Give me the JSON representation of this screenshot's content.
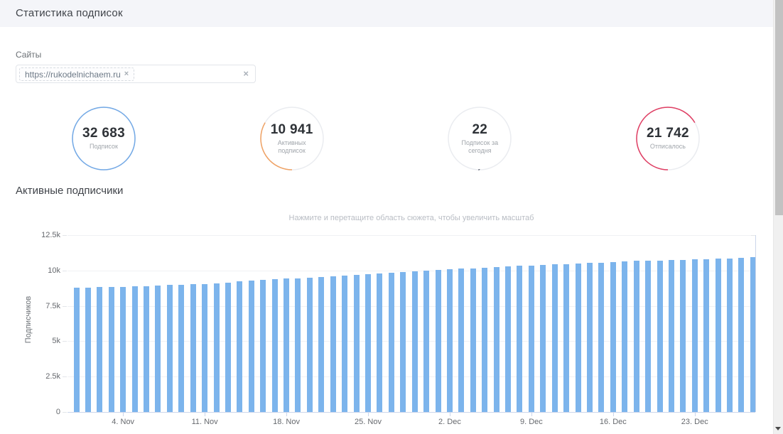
{
  "header": {
    "title": "Статистика подписок"
  },
  "sites": {
    "label": "Сайты",
    "tag": {
      "url": "https://rukodelnichaem.ru",
      "remove_icon": "×"
    },
    "clear_icon": "×"
  },
  "stats": {
    "track_color": "#eaecf0",
    "items": [
      {
        "value": "32 683",
        "label": "Подписок",
        "percent": 100,
        "color": "#73a9e6"
      },
      {
        "value": "10 941",
        "label": "Активных подписок",
        "percent": 33.5,
        "color": "#f0a264"
      },
      {
        "value": "22",
        "label": "Подписок за сегодня",
        "percent": 0.6,
        "color": "#3b4252"
      },
      {
        "value": "21 742",
        "label": "Отписалось",
        "percent": 66.5,
        "color": "#e03e63"
      }
    ]
  },
  "section": {
    "title": "Активные подписчики"
  },
  "chart_data": {
    "type": "bar",
    "title": "",
    "hint": "Нажмите и перетащите область сюжета, чтобы увеличить масштаб",
    "ylabel": "Подписчиков",
    "ylim": [
      0,
      12500
    ],
    "bar_color": "#7cb4ec",
    "axis_line_color": "#ccd6eb",
    "grid": true,
    "yticks": [
      {
        "v": 0,
        "label": "0"
      },
      {
        "v": 2500,
        "label": "2.5k"
      },
      {
        "v": 5000,
        "label": "5k"
      },
      {
        "v": 7500,
        "label": "7.5k"
      },
      {
        "v": 10000,
        "label": "10k"
      },
      {
        "v": 12500,
        "label": "12.5k"
      }
    ],
    "xticks": [
      {
        "day": 4,
        "label": "4. Nov"
      },
      {
        "day": 11,
        "label": "11. Nov"
      },
      {
        "day": 18,
        "label": "18. Nov"
      },
      {
        "day": 25,
        "label": "25. Nov"
      },
      {
        "day": 32,
        "label": "2. Dec"
      },
      {
        "day": 39,
        "label": "9. Dec"
      },
      {
        "day": 46,
        "label": "16. Dec"
      },
      {
        "day": 53,
        "label": "23. Dec"
      }
    ],
    "values": [
      8780,
      8800,
      8820,
      8840,
      8860,
      8880,
      8910,
      8950,
      8980,
      9000,
      9030,
      9060,
      9100,
      9160,
      9250,
      9300,
      9340,
      9380,
      9420,
      9460,
      9500,
      9550,
      9600,
      9650,
      9700,
      9750,
      9800,
      9850,
      9900,
      9950,
      10000,
      10050,
      10090,
      10120,
      10160,
      10200,
      10250,
      10290,
      10320,
      10350,
      10380,
      10420,
      10450,
      10480,
      10520,
      10560,
      10600,
      10640,
      10670,
      10690,
      10710,
      10740,
      10760,
      10780,
      10800,
      10830,
      10860,
      10900,
      10941
    ]
  }
}
